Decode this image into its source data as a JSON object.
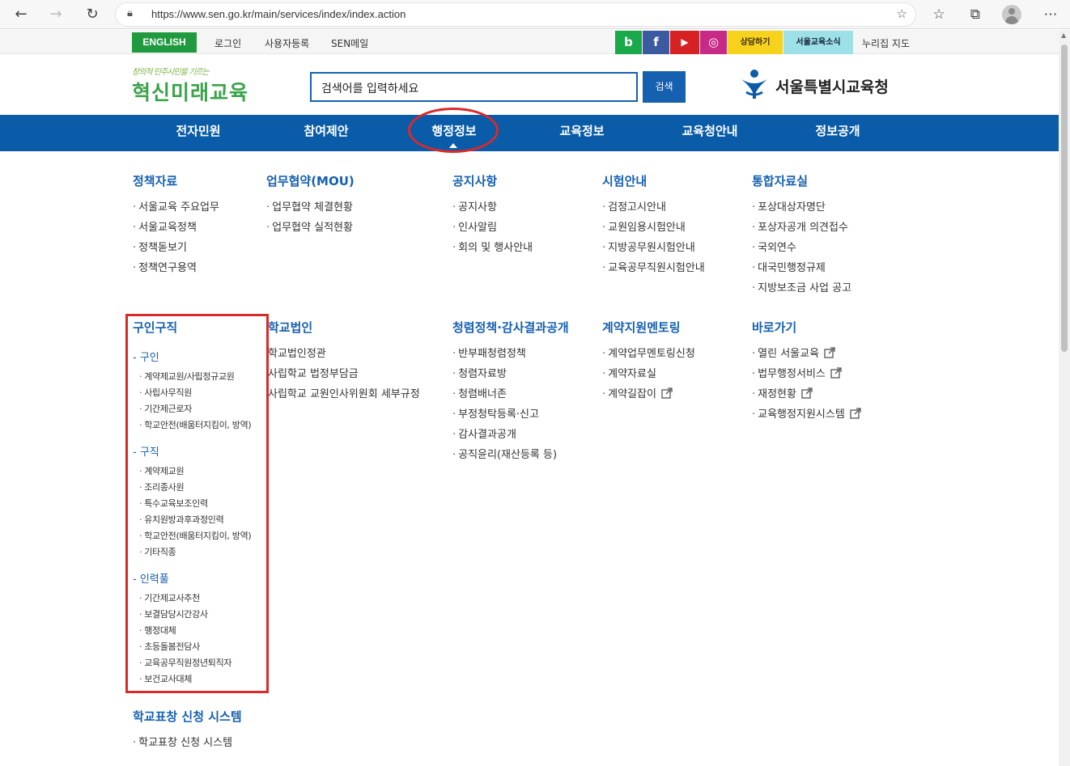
{
  "browser": {
    "url": "https://www.sen.go.kr/main/services/index/index.action"
  },
  "utility": {
    "english": "ENGLISH",
    "login": "로그인",
    "register": "사용자등록",
    "senmail": "SEN메일",
    "sns_blog": "b",
    "sns_facebook": "f",
    "sns_youtube": "▶",
    "sns_instagram": "◎",
    "talk": "상담하기",
    "news": "서울교육소식",
    "nurijip": "누리집 지도"
  },
  "header": {
    "logo_tagline": "창의적 민주시민을 기르는",
    "logo_main": "혁신미래교육",
    "search_placeholder": "검색어를 입력하세요",
    "search_button": "검색",
    "brand_name": "서울특별시교육청"
  },
  "gnb": [
    "전자민원",
    "참여제안",
    "행정정보",
    "교육정보",
    "교육청안내",
    "정보공개"
  ],
  "menu_row1": [
    {
      "title": "정책자료",
      "items": [
        "서울교육 주요업무",
        "서울교육정책",
        "정책돋보기",
        "정책연구용역"
      ]
    },
    {
      "title": "업무협약(MOU)",
      "items": [
        "업무협약 체결현황",
        "업무협약 실적현황"
      ]
    },
    {
      "title": "공지사항",
      "items": [
        "공지사항",
        "인사알림",
        "회의 및 행사안내"
      ]
    },
    {
      "title": "시험안내",
      "items": [
        "검정고시안내",
        "교원임용시험안내",
        "지방공무원시험안내",
        "교육공무직원시험안내"
      ]
    },
    {
      "title": "통합자료실",
      "items": [
        "포상대상자명단",
        "포상자공개 의견접수",
        "국외연수",
        "대국민행정규제",
        "지방보조금 사업 공고"
      ]
    }
  ],
  "recruit": {
    "title": "구인구직",
    "groups": [
      {
        "label": "- 구인",
        "items": [
          "계약제교원/사립정규교원",
          "사립사무직원",
          "기간제근로자",
          "학교안전(배움터지킴이, 방역)"
        ]
      },
      {
        "label": "- 구직",
        "items": [
          "계약제교원",
          "조리종사원",
          "특수교육보조인력",
          "유치원방과후과정인력",
          "학교안전(배움터지킴이, 방역)",
          "기타직종"
        ]
      },
      {
        "label": "- 인력풀",
        "items": [
          "기간제교사추천",
          "보결담당시간강사",
          "행정대체",
          "초등돌봄전담사",
          "교육공무직원정년퇴직자",
          "보건교사대체"
        ]
      }
    ]
  },
  "menu_row2": [
    {
      "title": "학교법인",
      "items": [
        "학교법인정관",
        "사립학교 법정부담금",
        "사립학교 교원인사위원회 세부규정"
      ]
    },
    {
      "title": "청렴정책·감사결과공개",
      "items": [
        "반부패청렴정책",
        "청렴자료방",
        "청렴배너존",
        "부정청탁등록·신고",
        "감사결과공개",
        "공직윤리(재산등록 등)"
      ]
    },
    {
      "title": "계약지원멘토링",
      "items": [
        "계약업무멘토링신청",
        "계약자료실",
        "계약길잡이"
      ]
    },
    {
      "title": "바로가기",
      "items": [
        "열린 서울교육",
        "법무행정서비스",
        "재정현황",
        "교육행정지원시스템"
      ]
    }
  ],
  "award": {
    "title": "학교표창 신청 시스템",
    "items": [
      "학교표창 신청 시스템"
    ]
  },
  "colors": {
    "nav_blue": "#0a5ba8",
    "link_blue": "#1660b0",
    "english_green": "#1f9a3e",
    "highlight_red": "#d92a2a"
  }
}
